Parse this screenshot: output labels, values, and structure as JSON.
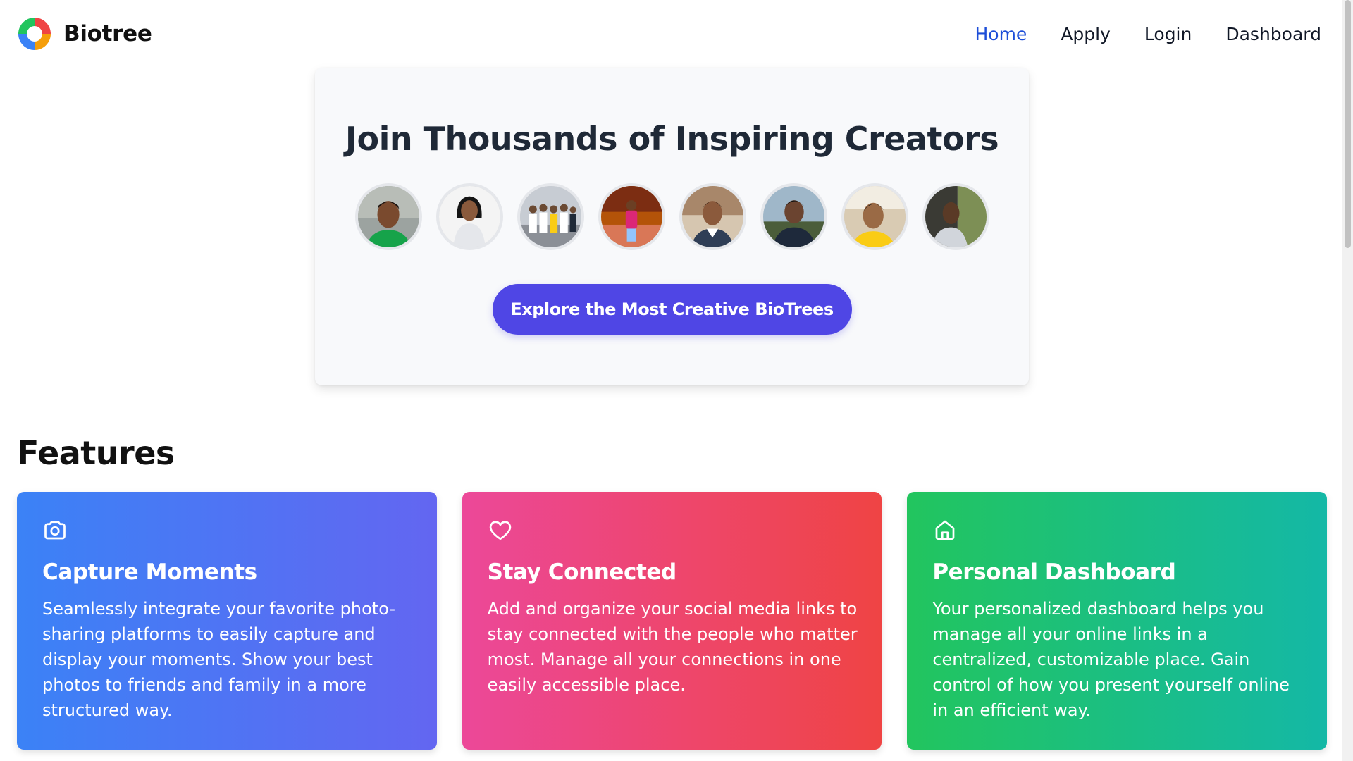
{
  "brand": {
    "name": "Biotree",
    "logo_icon": "pie-logo-icon"
  },
  "nav": {
    "items": [
      {
        "label": "Home",
        "active": true
      },
      {
        "label": "Apply",
        "active": false
      },
      {
        "label": "Login",
        "active": false
      },
      {
        "label": "Dashboard",
        "active": false
      }
    ],
    "active_color": "#1d4ed8"
  },
  "hero": {
    "title": "Join Thousands of Inspiring Creators",
    "cta_label": "Explore the Most Creative BioTrees",
    "cta_color": "#4f46e5",
    "avatar_count": 8
  },
  "features": {
    "heading": "Features",
    "cards": [
      {
        "icon": "camera-icon",
        "title": "Capture Moments",
        "text": "Seamlessly integrate your favorite photo-sharing platforms to easily capture and display your moments. Show your best photos to friends and family in a more structured way.",
        "colors": [
          "#3b82f6",
          "#6366f1"
        ]
      },
      {
        "icon": "heart-icon",
        "title": "Stay Connected",
        "text": "Add and organize your social media links to stay connected with the people who matter most. Manage all your connections in one easily accessible place.",
        "colors": [
          "#ec4899",
          "#ef4444"
        ]
      },
      {
        "icon": "home-icon",
        "title": "Personal Dashboard",
        "text": "Your personalized dashboard helps you manage all your online links in a centralized, customizable place. Gain control of how you present yourself online in an efficient way.",
        "colors": [
          "#22c55e",
          "#14b8a6"
        ]
      }
    ]
  }
}
